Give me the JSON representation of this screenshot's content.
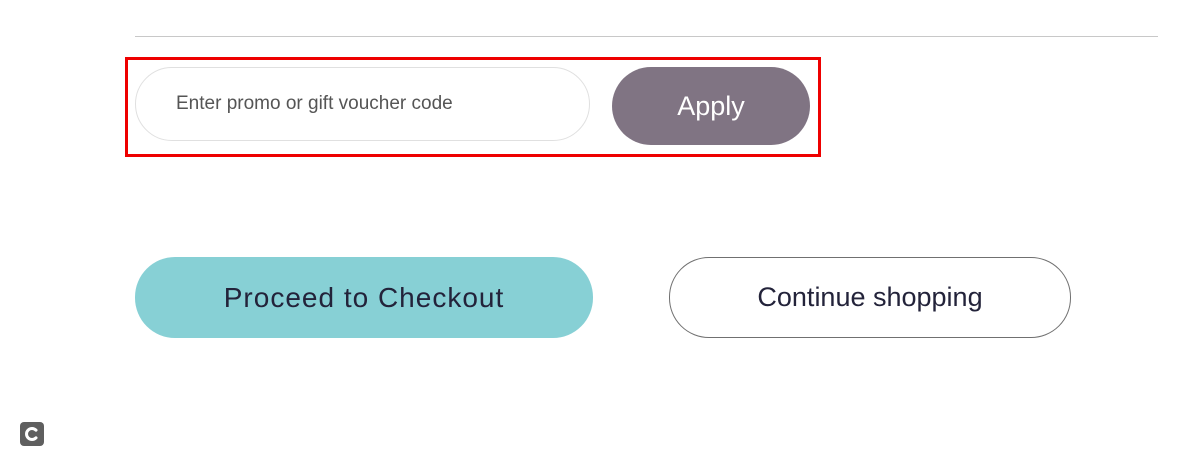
{
  "promo": {
    "placeholder": "Enter promo or gift voucher code",
    "value": "",
    "apply_label": "Apply"
  },
  "actions": {
    "checkout_label": "Proceed to Checkout",
    "continue_label": "Continue shopping"
  },
  "icons": {
    "corner": "c-logo-icon"
  },
  "colors": {
    "highlight": "#ee0000",
    "apply_bg": "#807483",
    "checkout_bg": "#87d0d5",
    "text_dark": "#23233a"
  }
}
